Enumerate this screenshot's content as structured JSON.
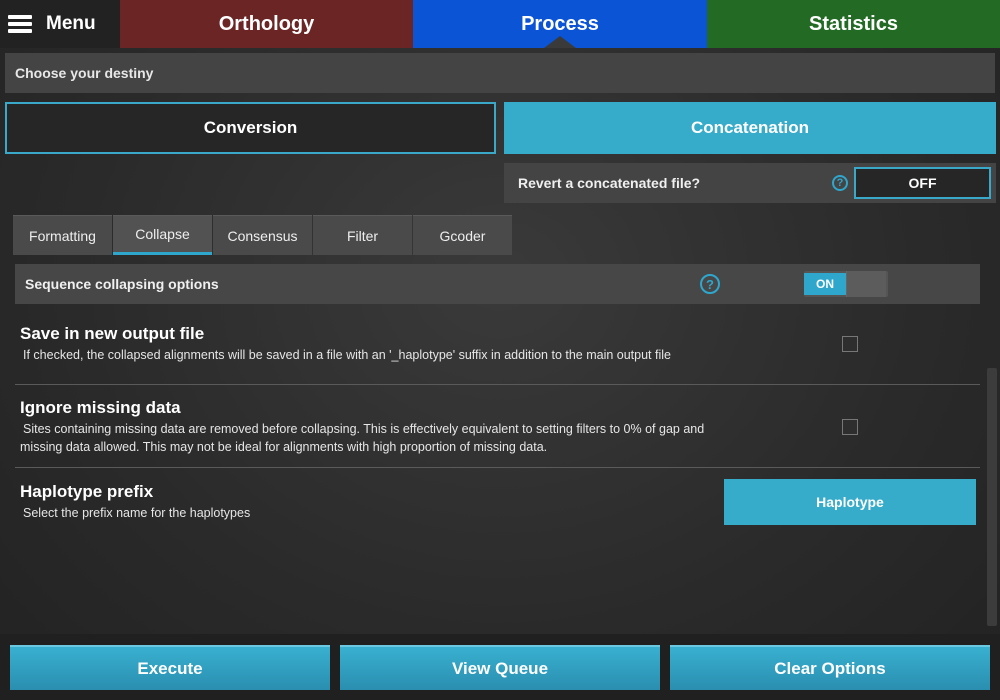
{
  "topbar": {
    "menu_label": "Menu",
    "tabs": [
      {
        "label": "Orthology",
        "color": "#6b2525"
      },
      {
        "label": "Process",
        "color": "#0b54d6"
      },
      {
        "label": "Statistics",
        "color": "#236b25"
      }
    ]
  },
  "destiny": {
    "label": "Choose your destiny"
  },
  "mode": {
    "conversion_label": "Conversion",
    "concatenation_label": "Concatenation"
  },
  "revert": {
    "label": "Revert a concatenated file?",
    "help_icon": "?",
    "toggle_label": "OFF"
  },
  "subtabs": [
    {
      "label": "Formatting"
    },
    {
      "label": "Collapse"
    },
    {
      "label": "Consensus"
    },
    {
      "label": "Filter"
    },
    {
      "label": "Gcoder"
    }
  ],
  "section": {
    "title": "Sequence collapsing options",
    "help_icon": "?",
    "toggle_on_label": "ON"
  },
  "options": {
    "save_new": {
      "title": "Save in new output file",
      "desc": "If checked, the collapsed alignments will be saved in a file with an '_haplotype' suffix in addition to the main output file"
    },
    "ignore_missing": {
      "title": "Ignore missing data",
      "desc": "Sites containing missing data are removed before collapsing. This is effectively equivalent to setting filters to 0% of gap and missing data allowed. This may not be ideal for alignments with high proportion of missing data."
    },
    "haplotype_prefix": {
      "title": "Haplotype prefix",
      "desc": "Select the prefix name for the haplotypes",
      "button_label": "Haplotype"
    }
  },
  "bottom": {
    "execute_label": "Execute",
    "view_queue_label": "View Queue",
    "clear_label": "Clear Options"
  },
  "colors": {
    "accent": "#37abca",
    "help": "#2fa6cc"
  }
}
